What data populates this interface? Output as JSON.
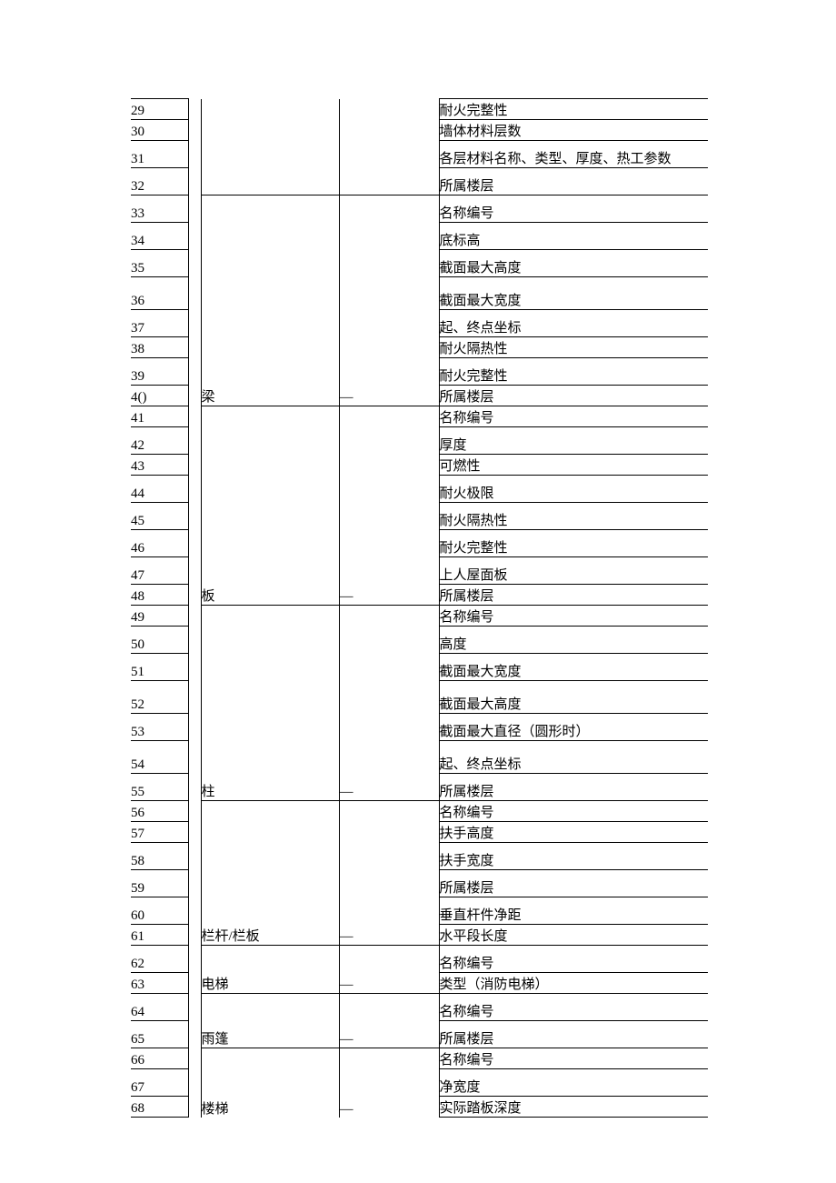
{
  "dash": "—",
  "groups": [
    {
      "category": "",
      "dash": "",
      "rows": [
        {
          "num": "29",
          "attr": "耐火完整性"
        },
        {
          "num": "30",
          "attr": "墙体材料层数"
        },
        {
          "num": "31",
          "attr": "各层材料名称、类型、厚度、热工参数"
        },
        {
          "num": "32",
          "attr": "所属楼层"
        }
      ]
    },
    {
      "category": "梁",
      "dash": "—",
      "rows": [
        {
          "num": "33",
          "attr": "名称编号"
        },
        {
          "num": "34",
          "attr": "底标高"
        },
        {
          "num": "35",
          "attr": "截面最大高度"
        },
        {
          "num": "36",
          "attr": "截面最大宽度"
        },
        {
          "num": "37",
          "attr": "起、终点坐标"
        },
        {
          "num": "38",
          "attr": "耐火隔热性"
        },
        {
          "num": "39",
          "attr": "耐火完整性"
        },
        {
          "num": "4()",
          "attr": "所属楼层"
        }
      ]
    },
    {
      "category": "板",
      "dash": "—",
      "rows": [
        {
          "num": "41",
          "attr": "名称编号"
        },
        {
          "num": "42",
          "attr": "厚度"
        },
        {
          "num": "43",
          "attr": "可燃性"
        },
        {
          "num": "44",
          "attr": "耐火极限"
        },
        {
          "num": "45",
          "attr": "耐火隔热性"
        },
        {
          "num": "46",
          "attr": "耐火完整性"
        },
        {
          "num": "47",
          "attr": "上人屋面板"
        },
        {
          "num": "48",
          "attr": "所属楼层"
        }
      ]
    },
    {
      "category": "柱",
      "dash": "—",
      "rows": [
        {
          "num": "49",
          "attr": "名称编号"
        },
        {
          "num": "50",
          "attr": "高度"
        },
        {
          "num": "51",
          "attr": "截面最大宽度"
        },
        {
          "num": "52",
          "attr": "截面最大高度"
        },
        {
          "num": "53",
          "attr": "截面最大直径（圆形时）"
        },
        {
          "num": "54",
          "attr": "起、终点坐标"
        },
        {
          "num": "55",
          "attr": "所属楼层"
        }
      ]
    },
    {
      "category": "栏杆/栏板",
      "dash": "—",
      "rows": [
        {
          "num": "56",
          "attr": "名称编号"
        },
        {
          "num": "57",
          "attr": "扶手高度"
        },
        {
          "num": "58",
          "attr": "扶手宽度"
        },
        {
          "num": "59",
          "attr": "所属楼层"
        },
        {
          "num": "60",
          "attr": "垂直杆件净距"
        },
        {
          "num": "61",
          "attr": "水平段长度"
        }
      ]
    },
    {
      "category": "电梯",
      "dash": "—",
      "rows": [
        {
          "num": "62",
          "attr": "名称编号"
        },
        {
          "num": "63",
          "attr": "类型（消防电梯）"
        }
      ]
    },
    {
      "category": "雨篷",
      "dash": "—",
      "rows": [
        {
          "num": "64",
          "attr": "名称编号"
        },
        {
          "num": "65",
          "attr": "所属楼层"
        }
      ]
    },
    {
      "category": "楼梯",
      "dash": "—",
      "rows": [
        {
          "num": "66",
          "attr": "名称编号"
        },
        {
          "num": "67",
          "attr": "净宽度"
        },
        {
          "num": "68",
          "attr": "实际踏板深度"
        }
      ]
    }
  ],
  "heights": {
    "g0": [
      "h1",
      "h1",
      "h2",
      "h2"
    ],
    "g1": [
      "h2",
      "h2",
      "h2",
      "h3",
      "h2",
      "h1",
      "h2",
      "h1"
    ],
    "g2": [
      "h1",
      "h2",
      "h1",
      "h2",
      "h2",
      "h2",
      "h2",
      "h1"
    ],
    "g3": [
      "h1",
      "h2",
      "h2",
      "h3",
      "h2",
      "h3",
      "h2"
    ],
    "g4": [
      "h1",
      "h1",
      "h2",
      "h2",
      "h2",
      "h1"
    ],
    "g5": [
      "h2",
      "h1"
    ],
    "g6": [
      "h2",
      "h2"
    ],
    "g7": [
      "h1",
      "h2",
      "h1"
    ]
  }
}
